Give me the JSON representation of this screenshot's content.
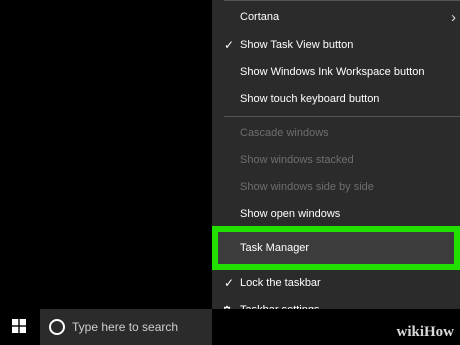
{
  "context_menu": {
    "items": [
      {
        "label": "Cortana",
        "checked": false,
        "disabled": false,
        "submenu": true
      },
      {
        "label": "Show Task View button",
        "checked": true,
        "disabled": false
      },
      {
        "label": "Show Windows Ink Workspace button",
        "checked": false,
        "disabled": false
      },
      {
        "label": "Show touch keyboard button",
        "checked": false,
        "disabled": false
      },
      {
        "label": "Cascade windows",
        "checked": false,
        "disabled": true
      },
      {
        "label": "Show windows stacked",
        "checked": false,
        "disabled": true
      },
      {
        "label": "Show windows side by side",
        "checked": false,
        "disabled": true
      },
      {
        "label": "Show open windows",
        "checked": false,
        "disabled": false
      },
      {
        "label": "Task Manager",
        "checked": false,
        "disabled": false,
        "highlighted": true
      },
      {
        "label": "Lock the taskbar",
        "checked": true,
        "disabled": false
      },
      {
        "label": "Taskbar settings",
        "icon": "gear-icon",
        "disabled": false
      }
    ],
    "highlight_color": "#22e000"
  },
  "taskbar": {
    "search_placeholder": "Type here to search"
  },
  "watermark": {
    "text_wiki": "wiki",
    "text_how": "How"
  }
}
